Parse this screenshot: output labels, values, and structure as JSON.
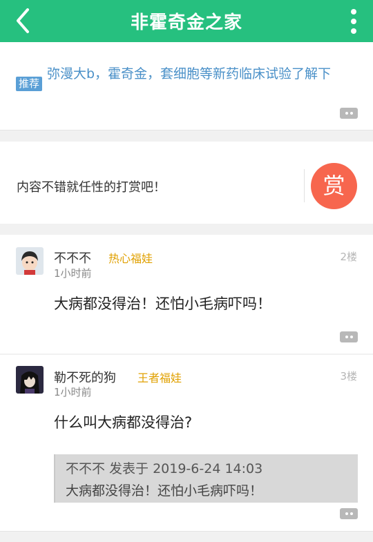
{
  "header": {
    "title": "非霍奇金之家"
  },
  "recommend": {
    "tag": "推荐",
    "text": "弥漫大b，霍奇金，套细胞等新药临床试验了解下"
  },
  "reward": {
    "prompt": "内容不错就任性的打赏吧！",
    "button_label": "赏",
    "button_color": "#f7664e"
  },
  "posts": [
    {
      "username": "不不不",
      "badge": "热心福娃",
      "floor": "2楼",
      "time": "1小时前",
      "content": "大病都没得治！还怕小毛病吓吗！"
    },
    {
      "username": "勒不死的狗",
      "badge": "王者福娃",
      "floor": "3楼",
      "time": "1小时前",
      "content": "什么叫大病都没得治?",
      "quote": {
        "header": "不不不 发表于 2019-6-24 14:03",
        "text": "大病都没得治！还怕小毛病吓吗！"
      }
    }
  ],
  "colors": {
    "header_bg": "#26c07f",
    "badge": "#e0a000",
    "link": "#4a90c8"
  }
}
